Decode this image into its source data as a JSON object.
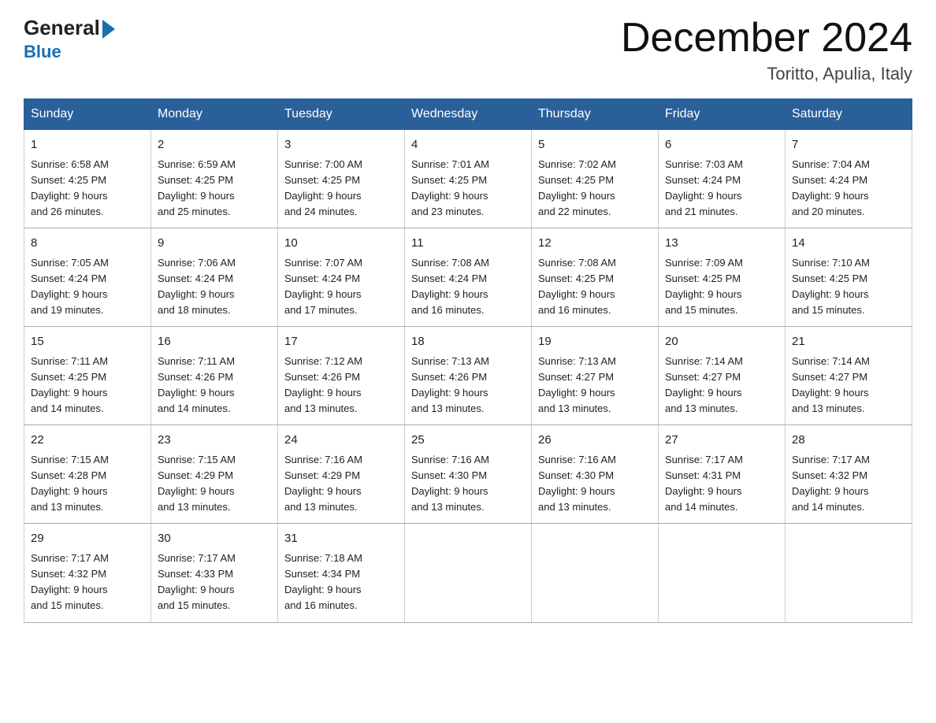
{
  "header": {
    "logo_general": "General",
    "logo_blue": "Blue",
    "month_title": "December 2024",
    "location": "Toritto, Apulia, Italy"
  },
  "days_of_week": [
    "Sunday",
    "Monday",
    "Tuesday",
    "Wednesday",
    "Thursday",
    "Friday",
    "Saturday"
  ],
  "weeks": [
    [
      {
        "day": "1",
        "sunrise": "6:58 AM",
        "sunset": "4:25 PM",
        "daylight": "9 hours and 26 minutes."
      },
      {
        "day": "2",
        "sunrise": "6:59 AM",
        "sunset": "4:25 PM",
        "daylight": "9 hours and 25 minutes."
      },
      {
        "day": "3",
        "sunrise": "7:00 AM",
        "sunset": "4:25 PM",
        "daylight": "9 hours and 24 minutes."
      },
      {
        "day": "4",
        "sunrise": "7:01 AM",
        "sunset": "4:25 PM",
        "daylight": "9 hours and 23 minutes."
      },
      {
        "day": "5",
        "sunrise": "7:02 AM",
        "sunset": "4:25 PM",
        "daylight": "9 hours and 22 minutes."
      },
      {
        "day": "6",
        "sunrise": "7:03 AM",
        "sunset": "4:24 PM",
        "daylight": "9 hours and 21 minutes."
      },
      {
        "day": "7",
        "sunrise": "7:04 AM",
        "sunset": "4:24 PM",
        "daylight": "9 hours and 20 minutes."
      }
    ],
    [
      {
        "day": "8",
        "sunrise": "7:05 AM",
        "sunset": "4:24 PM",
        "daylight": "9 hours and 19 minutes."
      },
      {
        "day": "9",
        "sunrise": "7:06 AM",
        "sunset": "4:24 PM",
        "daylight": "9 hours and 18 minutes."
      },
      {
        "day": "10",
        "sunrise": "7:07 AM",
        "sunset": "4:24 PM",
        "daylight": "9 hours and 17 minutes."
      },
      {
        "day": "11",
        "sunrise": "7:08 AM",
        "sunset": "4:24 PM",
        "daylight": "9 hours and 16 minutes."
      },
      {
        "day": "12",
        "sunrise": "7:08 AM",
        "sunset": "4:25 PM",
        "daylight": "9 hours and 16 minutes."
      },
      {
        "day": "13",
        "sunrise": "7:09 AM",
        "sunset": "4:25 PM",
        "daylight": "9 hours and 15 minutes."
      },
      {
        "day": "14",
        "sunrise": "7:10 AM",
        "sunset": "4:25 PM",
        "daylight": "9 hours and 15 minutes."
      }
    ],
    [
      {
        "day": "15",
        "sunrise": "7:11 AM",
        "sunset": "4:25 PM",
        "daylight": "9 hours and 14 minutes."
      },
      {
        "day": "16",
        "sunrise": "7:11 AM",
        "sunset": "4:26 PM",
        "daylight": "9 hours and 14 minutes."
      },
      {
        "day": "17",
        "sunrise": "7:12 AM",
        "sunset": "4:26 PM",
        "daylight": "9 hours and 13 minutes."
      },
      {
        "day": "18",
        "sunrise": "7:13 AM",
        "sunset": "4:26 PM",
        "daylight": "9 hours and 13 minutes."
      },
      {
        "day": "19",
        "sunrise": "7:13 AM",
        "sunset": "4:27 PM",
        "daylight": "9 hours and 13 minutes."
      },
      {
        "day": "20",
        "sunrise": "7:14 AM",
        "sunset": "4:27 PM",
        "daylight": "9 hours and 13 minutes."
      },
      {
        "day": "21",
        "sunrise": "7:14 AM",
        "sunset": "4:27 PM",
        "daylight": "9 hours and 13 minutes."
      }
    ],
    [
      {
        "day": "22",
        "sunrise": "7:15 AM",
        "sunset": "4:28 PM",
        "daylight": "9 hours and 13 minutes."
      },
      {
        "day": "23",
        "sunrise": "7:15 AM",
        "sunset": "4:29 PM",
        "daylight": "9 hours and 13 minutes."
      },
      {
        "day": "24",
        "sunrise": "7:16 AM",
        "sunset": "4:29 PM",
        "daylight": "9 hours and 13 minutes."
      },
      {
        "day": "25",
        "sunrise": "7:16 AM",
        "sunset": "4:30 PM",
        "daylight": "9 hours and 13 minutes."
      },
      {
        "day": "26",
        "sunrise": "7:16 AM",
        "sunset": "4:30 PM",
        "daylight": "9 hours and 13 minutes."
      },
      {
        "day": "27",
        "sunrise": "7:17 AM",
        "sunset": "4:31 PM",
        "daylight": "9 hours and 14 minutes."
      },
      {
        "day": "28",
        "sunrise": "7:17 AM",
        "sunset": "4:32 PM",
        "daylight": "9 hours and 14 minutes."
      }
    ],
    [
      {
        "day": "29",
        "sunrise": "7:17 AM",
        "sunset": "4:32 PM",
        "daylight": "9 hours and 15 minutes."
      },
      {
        "day": "30",
        "sunrise": "7:17 AM",
        "sunset": "4:33 PM",
        "daylight": "9 hours and 15 minutes."
      },
      {
        "day": "31",
        "sunrise": "7:18 AM",
        "sunset": "4:34 PM",
        "daylight": "9 hours and 16 minutes."
      },
      {
        "day": "",
        "sunrise": "",
        "sunset": "",
        "daylight": ""
      },
      {
        "day": "",
        "sunrise": "",
        "sunset": "",
        "daylight": ""
      },
      {
        "day": "",
        "sunrise": "",
        "sunset": "",
        "daylight": ""
      },
      {
        "day": "",
        "sunrise": "",
        "sunset": "",
        "daylight": ""
      }
    ]
  ],
  "labels": {
    "sunrise_prefix": "Sunrise: ",
    "sunset_prefix": "Sunset: ",
    "daylight_prefix": "Daylight: "
  }
}
